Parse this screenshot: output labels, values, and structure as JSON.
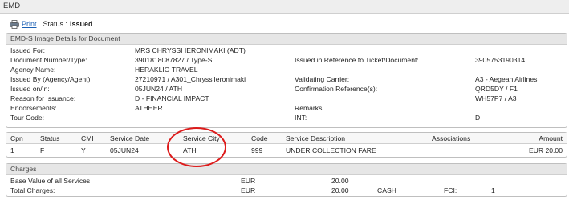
{
  "window": {
    "title": "EMD"
  },
  "toolbar": {
    "print_label": "Print",
    "status_label": "Status :",
    "status_value": "Issued"
  },
  "details": {
    "heading": "EMD-S Image Details for Document",
    "issued_for_label": "Issued For:",
    "issued_for_value": "MRS CHRYSSI IERONIMAKI (ADT)",
    "doc_label": "Document Number/Type:",
    "doc_value": "3901818087827 / Type-S",
    "ticket_ref_label": "Issued in Reference to Ticket/Document:",
    "ticket_ref_value": "3905753190314",
    "agency_label": "Agency Name:",
    "agency_value": "HERAKLIO TRAVEL",
    "issued_by_label": "Issued By (Agency/Agent):",
    "issued_by_value": "27210971 / A301_ChryssiIeronimaki",
    "carrier_label": "Validating Carrier:",
    "carrier_value": "A3 - Aegean Airlines",
    "issued_on_label": "Issued on/in:",
    "issued_on_value": "05JUN24 / ATH",
    "conf_label": "Confirmation Reference(s):",
    "conf_value_1": "QRD5DY / F1",
    "reason_label": "Reason for Issuance:",
    "reason_value": "D - FINANCIAL IMPACT",
    "conf_value_2": "WH57P7 / A3",
    "endorse_label": "Endorsements:",
    "endorse_value": "ATHHER",
    "remarks_label": "Remarks:",
    "remarks_value": "",
    "tour_label": "Tour Code:",
    "tour_value": "",
    "int_label": "INT:",
    "int_value": "D"
  },
  "services": {
    "headers": {
      "cpn": "Cpn",
      "status": "Status",
      "cmi": "CMI",
      "date": "Service Date",
      "city": "Service City",
      "code": "Code",
      "desc": "Service Description",
      "assoc": "Associations",
      "amount": "Amount"
    },
    "rows": [
      {
        "cpn": "1",
        "status": "F",
        "cmi": "Y",
        "date": "05JUN24",
        "city": "ATH",
        "code": "999",
        "desc": "UNDER COLLECTION FARE",
        "assoc": "",
        "amount": "EUR 20.00"
      }
    ]
  },
  "charges": {
    "heading": "Charges",
    "base_label": "Base Value of all Services:",
    "base_currency": "EUR",
    "base_amount": "20.00",
    "total_label": "Total Charges:",
    "total_currency": "EUR",
    "total_amount": "20.00",
    "payment": "CASH",
    "fci_label": "FCI:",
    "fci_value": "1"
  },
  "colors": {
    "annotation_circle": "#dd1b1b",
    "link": "#1a5fb4"
  }
}
